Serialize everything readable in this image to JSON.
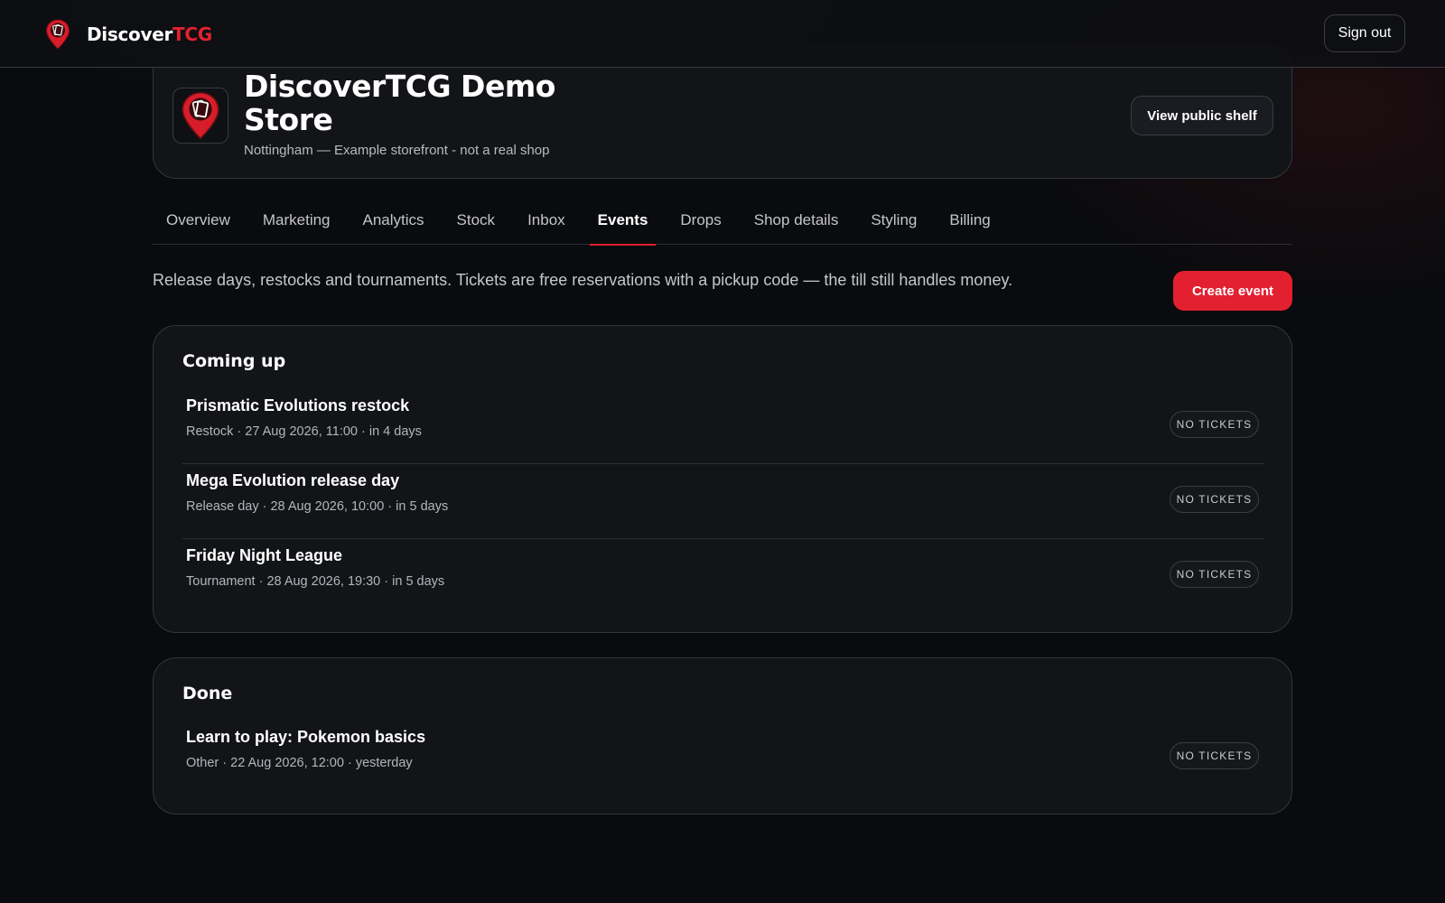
{
  "brand": {
    "name_part1": "Discover",
    "name_part2": "TCG",
    "accent_color": "#e3202f",
    "logo_icon": "card-map-pin-icon"
  },
  "header": {
    "signout_label": "Sign out"
  },
  "store": {
    "name": "DiscoverTCG Demo Store",
    "subtitle": "Nottingham — Example storefront - not a real shop",
    "view_public_label": "View public shelf"
  },
  "tabs": [
    {
      "label": "Overview",
      "active": false
    },
    {
      "label": "Marketing",
      "active": false
    },
    {
      "label": "Analytics",
      "active": false
    },
    {
      "label": "Stock",
      "active": false
    },
    {
      "label": "Inbox",
      "active": false
    },
    {
      "label": "Events",
      "active": true
    },
    {
      "label": "Drops",
      "active": false
    },
    {
      "label": "Shop details",
      "active": false
    },
    {
      "label": "Styling",
      "active": false
    },
    {
      "label": "Billing",
      "active": false
    }
  ],
  "intro": {
    "text": "Release days, restocks and tournaments. Tickets are free reservations with a pickup code — the till still handles money.",
    "create_label": "Create event"
  },
  "upcoming": {
    "title": "Coming up",
    "events": [
      {
        "title": "Prismatic Evolutions restock",
        "meta": "Restock · 27 Aug 2026, 11:00 · in 4 days",
        "badge": "NO TICKETS"
      },
      {
        "title": "Mega Evolution release day",
        "meta": "Release day · 28 Aug 2026, 10:00 · in 5 days",
        "badge": "NO TICKETS"
      },
      {
        "title": "Friday Night League",
        "meta": "Tournament · 28 Aug 2026, 19:30 · in 5 days",
        "badge": "NO TICKETS"
      }
    ]
  },
  "done": {
    "title": "Done",
    "events": [
      {
        "title": "Learn to play: Pokemon basics",
        "meta": "Other · 22 Aug 2026, 12:00 · yesterday",
        "badge": "NO TICKETS"
      }
    ]
  }
}
